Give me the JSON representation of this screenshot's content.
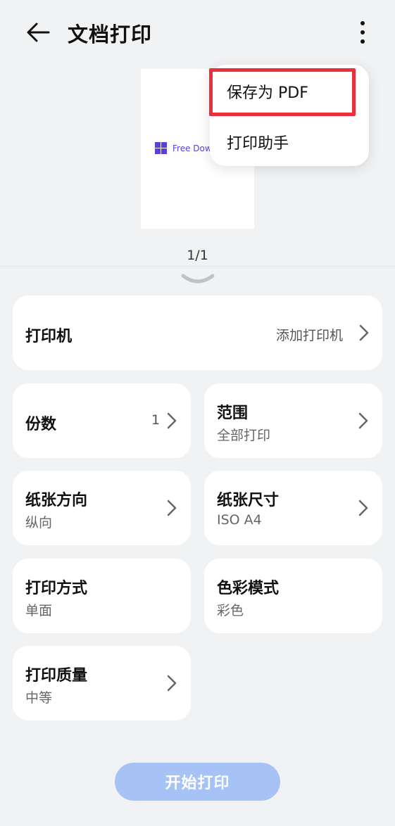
{
  "header": {
    "title": "文档打印",
    "back_icon": "arrow-left-icon",
    "more_icon": "more-vertical-icon"
  },
  "preview": {
    "doc_text": "Free Dow",
    "page_indicator": "1/1"
  },
  "menu": {
    "items": [
      {
        "label": "保存为 PDF"
      },
      {
        "label": "打印助手"
      }
    ],
    "highlight_color": "#ee2f3b"
  },
  "printer": {
    "title": "打印机",
    "value": "添加打印机"
  },
  "settings": {
    "copies": {
      "title": "份数",
      "value": "1"
    },
    "range": {
      "title": "范围",
      "sub": "全部打印"
    },
    "orientation": {
      "title": "纸张方向",
      "sub": "纵向"
    },
    "paper_size": {
      "title": "纸张尺寸",
      "sub": "ISO A4"
    },
    "print_mode": {
      "title": "打印方式",
      "sub": "单面"
    },
    "color_mode": {
      "title": "色彩模式",
      "sub": "彩色"
    },
    "quality": {
      "title": "打印质量",
      "sub": "中等"
    }
  },
  "start_button": {
    "label": "开始打印",
    "color": "#a7c3f6"
  }
}
